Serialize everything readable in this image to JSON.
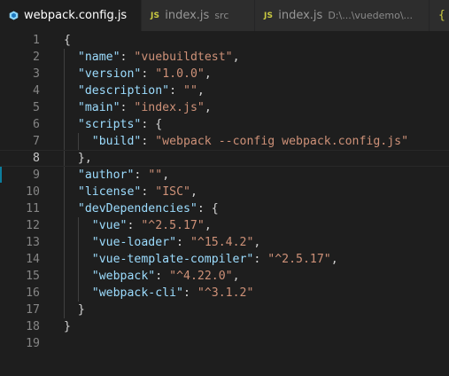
{
  "tabs": [
    {
      "name": "webpack.config.js",
      "icon": "webpack-icon",
      "desc": "",
      "active": true
    },
    {
      "name": "index.js",
      "icon": "js-icon",
      "icon_text": "JS",
      "desc": "src",
      "active": false
    },
    {
      "name": "index.js",
      "icon": "js-icon",
      "icon_text": "JS",
      "desc": "D:\\...\\vuedemo\\...",
      "active": false
    },
    {
      "name": "",
      "icon": "json-icon",
      "icon_text": "{",
      "desc": "",
      "active": false
    }
  ],
  "editor": {
    "current_line": 8,
    "lines": [
      {
        "n": "1",
        "tokens": [
          {
            "t": "{",
            "c": "punc"
          }
        ]
      },
      {
        "n": "2",
        "tokens": [
          {
            "t": "  ",
            "c": "punc"
          },
          {
            "t": "\"name\"",
            "c": "key"
          },
          {
            "t": ": ",
            "c": "punc"
          },
          {
            "t": "\"vuebuildtest\"",
            "c": "str"
          },
          {
            "t": ",",
            "c": "punc"
          }
        ]
      },
      {
        "n": "3",
        "tokens": [
          {
            "t": "  ",
            "c": "punc"
          },
          {
            "t": "\"version\"",
            "c": "key"
          },
          {
            "t": ": ",
            "c": "punc"
          },
          {
            "t": "\"1.0.0\"",
            "c": "str"
          },
          {
            "t": ",",
            "c": "punc"
          }
        ]
      },
      {
        "n": "4",
        "tokens": [
          {
            "t": "  ",
            "c": "punc"
          },
          {
            "t": "\"description\"",
            "c": "key"
          },
          {
            "t": ": ",
            "c": "punc"
          },
          {
            "t": "\"\"",
            "c": "str"
          },
          {
            "t": ",",
            "c": "punc"
          }
        ]
      },
      {
        "n": "5",
        "tokens": [
          {
            "t": "  ",
            "c": "punc"
          },
          {
            "t": "\"main\"",
            "c": "key"
          },
          {
            "t": ": ",
            "c": "punc"
          },
          {
            "t": "\"index.js\"",
            "c": "str"
          },
          {
            "t": ",",
            "c": "punc"
          }
        ]
      },
      {
        "n": "6",
        "tokens": [
          {
            "t": "  ",
            "c": "punc"
          },
          {
            "t": "\"scripts\"",
            "c": "key"
          },
          {
            "t": ": {",
            "c": "punc"
          }
        ]
      },
      {
        "n": "7",
        "tokens": [
          {
            "t": "    ",
            "c": "punc"
          },
          {
            "t": "\"build\"",
            "c": "key"
          },
          {
            "t": ": ",
            "c": "punc"
          },
          {
            "t": "\"webpack --config webpack.config.js\"",
            "c": "str"
          }
        ]
      },
      {
        "n": "8",
        "tokens": [
          {
            "t": "  },",
            "c": "punc"
          }
        ]
      },
      {
        "n": "9",
        "tokens": [
          {
            "t": "  ",
            "c": "punc"
          },
          {
            "t": "\"author\"",
            "c": "key"
          },
          {
            "t": ": ",
            "c": "punc"
          },
          {
            "t": "\"\"",
            "c": "str"
          },
          {
            "t": ",",
            "c": "punc"
          }
        ]
      },
      {
        "n": "10",
        "tokens": [
          {
            "t": "  ",
            "c": "punc"
          },
          {
            "t": "\"license\"",
            "c": "key"
          },
          {
            "t": ": ",
            "c": "punc"
          },
          {
            "t": "\"ISC\"",
            "c": "str"
          },
          {
            "t": ",",
            "c": "punc"
          }
        ]
      },
      {
        "n": "11",
        "tokens": [
          {
            "t": "  ",
            "c": "punc"
          },
          {
            "t": "\"devDependencies\"",
            "c": "key"
          },
          {
            "t": ": {",
            "c": "punc"
          }
        ]
      },
      {
        "n": "12",
        "tokens": [
          {
            "t": "    ",
            "c": "punc"
          },
          {
            "t": "\"vue\"",
            "c": "key"
          },
          {
            "t": ": ",
            "c": "punc"
          },
          {
            "t": "\"^2.5.17\"",
            "c": "str"
          },
          {
            "t": ",",
            "c": "punc"
          }
        ]
      },
      {
        "n": "13",
        "tokens": [
          {
            "t": "    ",
            "c": "punc"
          },
          {
            "t": "\"vue-loader\"",
            "c": "key"
          },
          {
            "t": ": ",
            "c": "punc"
          },
          {
            "t": "\"^15.4.2\"",
            "c": "str"
          },
          {
            "t": ",",
            "c": "punc"
          }
        ]
      },
      {
        "n": "14",
        "tokens": [
          {
            "t": "    ",
            "c": "punc"
          },
          {
            "t": "\"vue-template-compiler\"",
            "c": "key"
          },
          {
            "t": ": ",
            "c": "punc"
          },
          {
            "t": "\"^2.5.17\"",
            "c": "str"
          },
          {
            "t": ",",
            "c": "punc"
          }
        ]
      },
      {
        "n": "15",
        "tokens": [
          {
            "t": "    ",
            "c": "punc"
          },
          {
            "t": "\"webpack\"",
            "c": "key"
          },
          {
            "t": ": ",
            "c": "punc"
          },
          {
            "t": "\"^4.22.0\"",
            "c": "str"
          },
          {
            "t": ",",
            "c": "punc"
          }
        ]
      },
      {
        "n": "16",
        "tokens": [
          {
            "t": "    ",
            "c": "punc"
          },
          {
            "t": "\"webpack-cli\"",
            "c": "key"
          },
          {
            "t": ": ",
            "c": "punc"
          },
          {
            "t": "\"^3.1.2\"",
            "c": "str"
          }
        ]
      },
      {
        "n": "17",
        "tokens": [
          {
            "t": "  }",
            "c": "punc"
          }
        ]
      },
      {
        "n": "18",
        "tokens": [
          {
            "t": "}",
            "c": "punc"
          }
        ]
      },
      {
        "n": "19",
        "tokens": []
      }
    ]
  },
  "colors": {
    "background": "#1e1e1e",
    "key": "#9cdcfe",
    "string": "#ce9178",
    "punctuation": "#d4d4d4",
    "line_number": "#858585",
    "webpack_icon": "#8dd6f9",
    "js_icon": "#cbcb41"
  }
}
